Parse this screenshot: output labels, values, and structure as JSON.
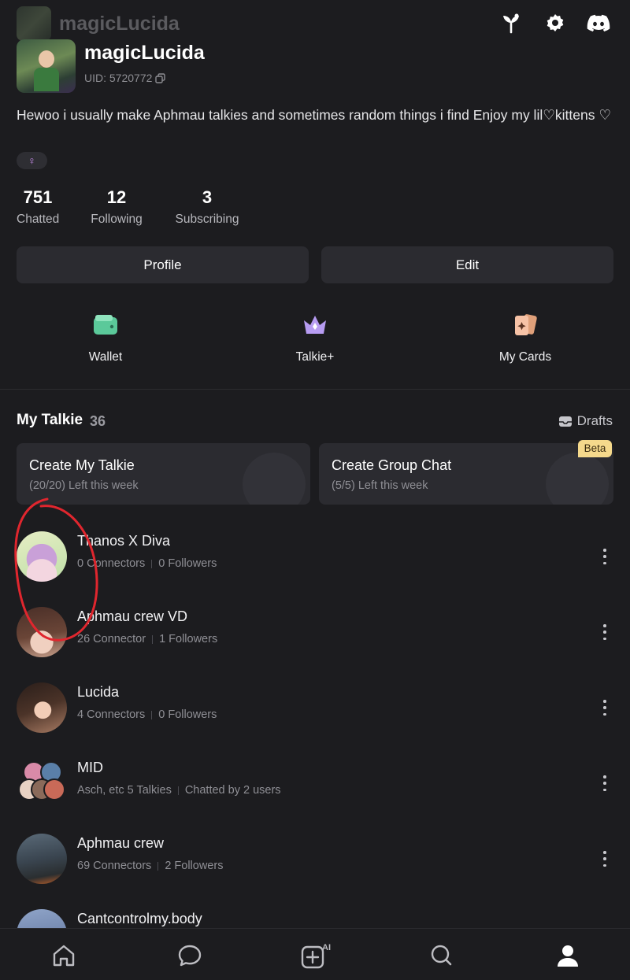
{
  "header": {
    "title": "magicLucida"
  },
  "profile": {
    "name": "magicLucida",
    "uid": "UID: 5720772",
    "bio": "Hewoo i usually make Aphmau talkies and sometimes random things i find Enjoy my lil♡kittens ♡",
    "gender": "♀"
  },
  "stats": [
    {
      "value": "751",
      "label": "Chatted"
    },
    {
      "value": "12",
      "label": "Following"
    },
    {
      "value": "3",
      "label": "Subscribing"
    }
  ],
  "buttons": {
    "profile": "Profile",
    "edit": "Edit"
  },
  "quick_links": [
    {
      "label": "Wallet",
      "icon": "wallet-icon"
    },
    {
      "label": "Talkie+",
      "icon": "crown-icon"
    },
    {
      "label": "My Cards",
      "icon": "cards-icon"
    }
  ],
  "my_talkie": {
    "title": "My Talkie",
    "count": "36",
    "drafts": "Drafts"
  },
  "create_cards": [
    {
      "title": "Create My Talkie",
      "subtitle": "(20/20) Left this week"
    },
    {
      "title": "Create Group Chat",
      "subtitle": "(5/5) Left this week",
      "badge": "Beta"
    }
  ],
  "talkies": [
    {
      "name": "Thanos X Diva",
      "stat1": "0 Connectors",
      "stat2": "0 Followers"
    },
    {
      "name": "Aphmau crew VD",
      "stat1": "26 Connector",
      "stat2": "1 Followers"
    },
    {
      "name": "Lucida",
      "stat1": "4 Connectors",
      "stat2": "0 Followers"
    },
    {
      "name": "MID",
      "stat1": "Asch, etc 5 Talkies",
      "stat2": "Chatted by 2 users"
    },
    {
      "name": "Aphmau crew",
      "stat1": "69 Connectors",
      "stat2": "2 Followers"
    },
    {
      "name": "Cantcontrolmy.body",
      "stat1": "",
      "stat2": ""
    }
  ],
  "bottom_nav": [
    "home-icon",
    "chat-icon",
    "create-ai-icon",
    "search-icon",
    "profile-icon"
  ],
  "colors": {
    "background": "#1c1c1f",
    "card": "#2b2b30",
    "badge": "#f5d98c",
    "annotation": "#e0262e"
  }
}
